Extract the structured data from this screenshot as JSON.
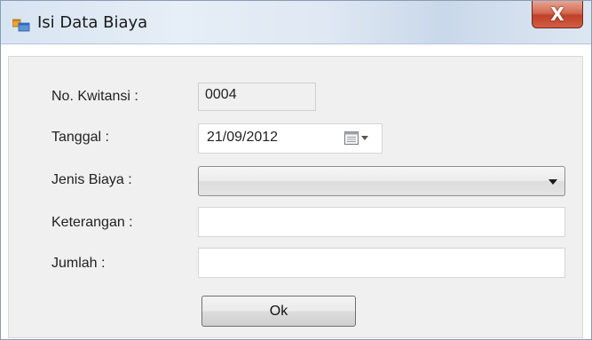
{
  "window": {
    "title": "Isi Data Biaya",
    "close_glyph": "X",
    "icons": {
      "app": "form-window-icon",
      "close": "close-icon"
    }
  },
  "form": {
    "kwitansi_label": "No. Kwitansi :",
    "kwitansi_value": "0004",
    "tanggal_label": "Tanggal :",
    "tanggal_value": "21/09/2012",
    "jenis_biaya_label": "Jenis Biaya :",
    "jenis_biaya_value": "",
    "keterangan_label": "Keterangan :",
    "keterangan_value": "",
    "jumlah_label": "Jumlah :",
    "jumlah_value": "",
    "ok_label": "Ok"
  },
  "colors": {
    "close_button": "#c0402a",
    "client_background": "#f0f0f0"
  }
}
